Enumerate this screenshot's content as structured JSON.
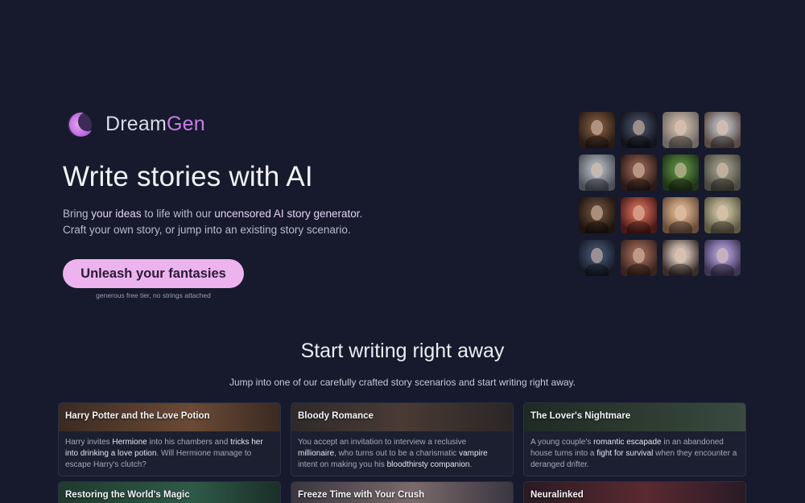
{
  "brand": {
    "name_main": "Dream",
    "name_accent": "Gen",
    "logo_icon": "crescent-moon-icon",
    "accent_color": "#c77ee6"
  },
  "hero": {
    "title": "Write stories with AI",
    "line1": {
      "a": "Bring ",
      "b": "your ideas",
      "c": " to life with our ",
      "d": "uncensored AI story generator",
      "e": "."
    },
    "line2": "Craft your own story, or jump into an existing story scenario.",
    "cta_label": "Unleash your fantasies",
    "cta_note": "generous free tier, no strings attached",
    "cta_color": "#ecb3ee"
  },
  "gallery": {
    "avatars": [
      "character-portrait-1",
      "character-portrait-2",
      "character-portrait-3",
      "character-portrait-4",
      "character-portrait-5",
      "character-portrait-6",
      "character-portrait-7",
      "character-portrait-8",
      "character-portrait-9",
      "character-portrait-10",
      "character-portrait-11",
      "character-portrait-12",
      "character-portrait-13",
      "character-portrait-14",
      "character-portrait-15",
      "character-portrait-16"
    ]
  },
  "scenarios": {
    "title": "Start writing right away",
    "subtitle": "Jump into one of our carefully crafted story scenarios and start writing right away.",
    "cards": [
      {
        "title": "Harry Potter and the Love Potion",
        "body": [
          [
            "Harry invites ",
            0
          ],
          [
            "Hermione",
            1
          ],
          [
            " into his chambers and ",
            0
          ],
          [
            "tricks her into drinking a love potion",
            1
          ],
          [
            ". Will Hermione manage to escape Harry's clutch?",
            0
          ]
        ]
      },
      {
        "title": "Bloody Romance",
        "body": [
          [
            "You accept an invitation to interview a reclusive ",
            0
          ],
          [
            "millionaire",
            1
          ],
          [
            ", who turns out to be a charismatic ",
            0
          ],
          [
            "vampire",
            1
          ],
          [
            " intent on making you his ",
            0
          ],
          [
            "bloodthirsty companion",
            1
          ],
          [
            ".",
            0
          ]
        ]
      },
      {
        "title": "The Lover's Nightmare",
        "body": [
          [
            "A young couple's ",
            0
          ],
          [
            "romantic escapade",
            1
          ],
          [
            " in an abandoned house turns into a ",
            0
          ],
          [
            "fight for survival",
            1
          ],
          [
            " when they encounter a deranged drifter.",
            0
          ]
        ]
      },
      {
        "title": "Restoring the World's Magic",
        "body": []
      },
      {
        "title": "Freeze Time with Your Crush",
        "body": []
      },
      {
        "title": "Neuralinked",
        "body": []
      }
    ]
  }
}
